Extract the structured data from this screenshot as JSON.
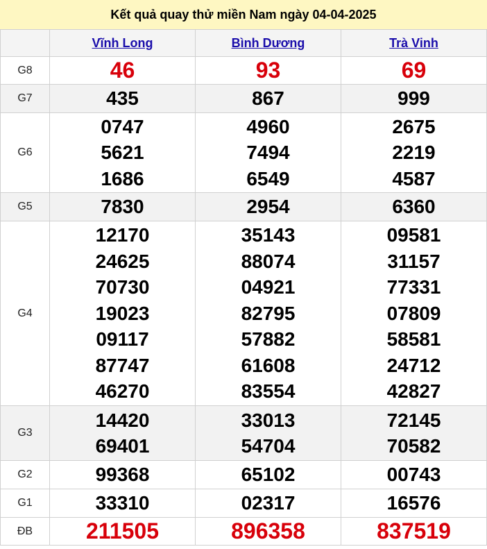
{
  "title": "Kết quả quay thử miền Nam ngày 04-04-2025",
  "provinces": [
    "Vĩnh Long",
    "Bình Dương",
    "Trà Vinh"
  ],
  "colors": {
    "special": "#d8000a",
    "link": "#1a0dab",
    "title_bg": "#fef7c2"
  },
  "prizes": [
    {
      "label": "G8",
      "values": [
        [
          "46"
        ],
        [
          "93"
        ],
        [
          "69"
        ]
      ]
    },
    {
      "label": "G7",
      "values": [
        [
          "435"
        ],
        [
          "867"
        ],
        [
          "999"
        ]
      ]
    },
    {
      "label": "G6",
      "values": [
        [
          "0747",
          "5621",
          "1686"
        ],
        [
          "4960",
          "7494",
          "6549"
        ],
        [
          "2675",
          "2219",
          "4587"
        ]
      ]
    },
    {
      "label": "G5",
      "values": [
        [
          "7830"
        ],
        [
          "2954"
        ],
        [
          "6360"
        ]
      ]
    },
    {
      "label": "G4",
      "values": [
        [
          "12170",
          "24625",
          "70730",
          "19023",
          "09117",
          "87747",
          "46270"
        ],
        [
          "35143",
          "88074",
          "04921",
          "82795",
          "57882",
          "61608",
          "83554"
        ],
        [
          "09581",
          "31157",
          "77331",
          "07809",
          "58581",
          "24712",
          "42827"
        ]
      ]
    },
    {
      "label": "G3",
      "values": [
        [
          "14420",
          "69401"
        ],
        [
          "33013",
          "54704"
        ],
        [
          "72145",
          "70582"
        ]
      ]
    },
    {
      "label": "G2",
      "values": [
        [
          "99368"
        ],
        [
          "65102"
        ],
        [
          "00743"
        ]
      ]
    },
    {
      "label": "G1",
      "values": [
        [
          "33310"
        ],
        [
          "02317"
        ],
        [
          "16576"
        ]
      ]
    },
    {
      "label": "ĐB",
      "values": [
        [
          "211505"
        ],
        [
          "896358"
        ],
        [
          "837519"
        ]
      ]
    }
  ]
}
